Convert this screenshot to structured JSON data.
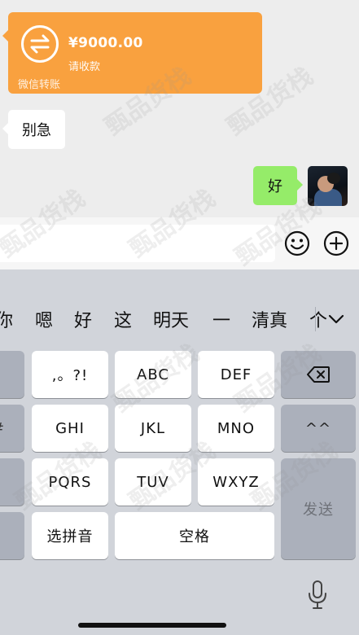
{
  "transfer": {
    "amount": "¥9000.00",
    "note": "请收款",
    "source": "微信转账",
    "color": "#f9a13f"
  },
  "messages": [
    {
      "side": "left",
      "text": "别急"
    },
    {
      "side": "right",
      "text": "好"
    }
  ],
  "input": {
    "value": ""
  },
  "candidates": [
    "你",
    "嗯",
    "好",
    "这",
    "明天",
    "一",
    "清真",
    "个"
  ],
  "keys": {
    "punct": ",。?!",
    "abc": "ABC",
    "def": "DEF",
    "ghi": "GHI",
    "jkl": "JKL",
    "mno": "MNO",
    "pqrs": "PQRS",
    "tuv": "TUV",
    "wxyz": "WXYZ",
    "pinyin": "选拼音",
    "space": "空格",
    "emoticon": "^^",
    "send": "发送",
    "left_cut_2": "#"
  },
  "watermark": "甄品货栈",
  "colors": {
    "sent_bubble": "#95ec69",
    "keyboard_bg": "#d1d4da"
  }
}
